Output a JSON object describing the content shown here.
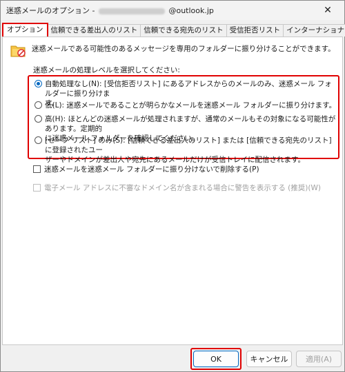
{
  "window": {
    "title_prefix": "迷惑メールのオプション -",
    "title_suffix": "@outlook.jp",
    "close_glyph": "✕"
  },
  "tabs": [
    {
      "label": "オプション",
      "active": true
    },
    {
      "label": "信頼できる差出人のリスト",
      "active": false
    },
    {
      "label": "信頼できる宛先のリスト",
      "active": false
    },
    {
      "label": "受信拒否リスト",
      "active": false
    },
    {
      "label": "インターナショナル",
      "active": false
    }
  ],
  "options": {
    "intro": "迷惑メールである可能性のあるメッセージを専用のフォルダーに振り分けることができます。",
    "intro_icon": "junk-mail-folder-icon",
    "level_heading": "迷惑メールの処理レベルを選択してください:",
    "levels": [
      {
        "text": "自動処理なし(N): [受信拒否リスト] にあるアドレスからのメールのみ、迷惑メール フォルダーに振り分けま\nす。",
        "checked": true
      },
      {
        "text": "低(L): 迷惑メールであることが明らかなメールを迷惑メール フォルダーに振り分けます。",
        "checked": false
      },
      {
        "text": "高(H): ほとんどの迷惑メールが処理されますが、通常のメールもその対象になる可能性があります。定期的\nに迷惑メール フォルダーを確認してください。",
        "checked": false
      },
      {
        "text": "[セーフ リスト] のみ(S): [信頼できる差出人のリスト] または [信頼できる宛先のリスト] に登録されたユー\nザーやドメインが差出人や宛先にあるメールだけが受信トレイに配信されます。",
        "checked": false
      }
    ],
    "delete_checkbox": "迷惑メールを迷惑メール フォルダーに振り分けないで削除する(P)",
    "warn_checkbox": "電子メール アドレスに不審なドメイン名が含まれる場合に警告を表示する (推奨)(W)"
  },
  "buttons": {
    "ok": "OK",
    "cancel": "キャンセル",
    "apply": "適用(A)"
  },
  "colors": {
    "highlight": "#e00000",
    "accent": "#0067c0"
  }
}
